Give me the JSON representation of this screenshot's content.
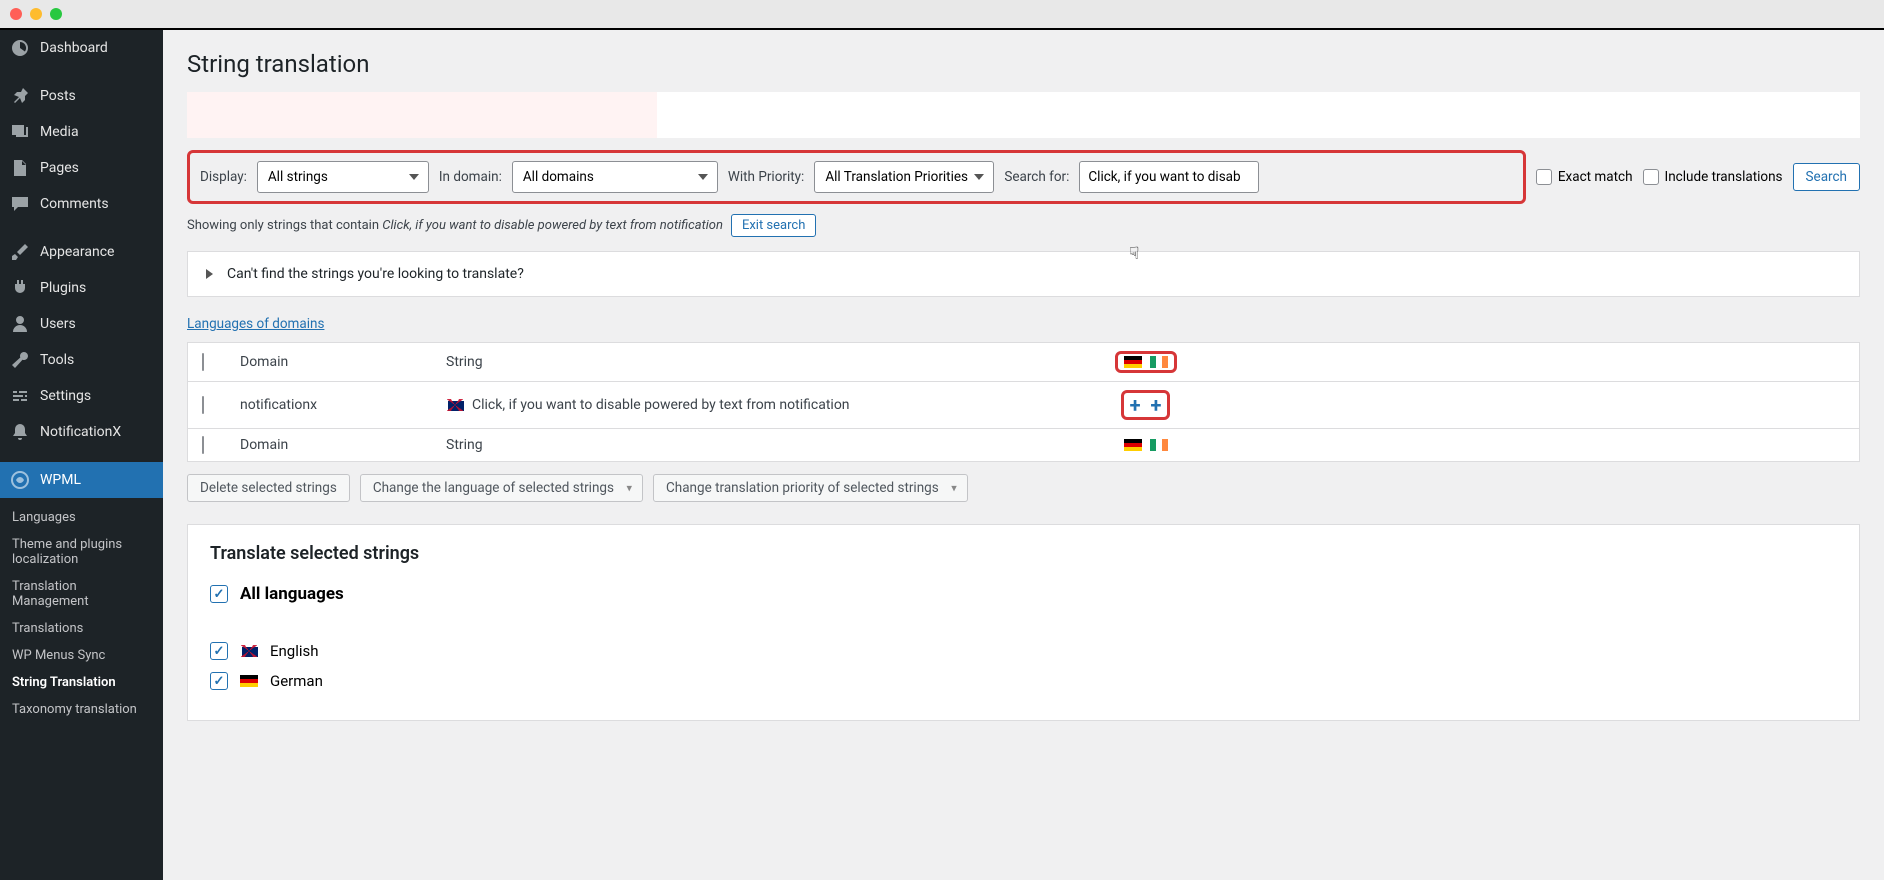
{
  "sidebar": {
    "items": [
      {
        "label": "Dashboard",
        "icon": "dashboard"
      },
      {
        "label": "Posts",
        "icon": "pin"
      },
      {
        "label": "Media",
        "icon": "media"
      },
      {
        "label": "Pages",
        "icon": "page"
      },
      {
        "label": "Comments",
        "icon": "comment"
      },
      {
        "label": "Appearance",
        "icon": "brush"
      },
      {
        "label": "Plugins",
        "icon": "plug"
      },
      {
        "label": "Users",
        "icon": "user"
      },
      {
        "label": "Tools",
        "icon": "wrench"
      },
      {
        "label": "Settings",
        "icon": "sliders"
      },
      {
        "label": "NotificationX",
        "icon": "notificationx"
      },
      {
        "label": "WPML",
        "icon": "wpml"
      }
    ],
    "submenu": [
      {
        "label": "Languages"
      },
      {
        "label": "Theme and plugins localization"
      },
      {
        "label": "Translation Management"
      },
      {
        "label": "Translations"
      },
      {
        "label": "WP Menus Sync"
      },
      {
        "label": "String Translation",
        "current": true
      },
      {
        "label": "Taxonomy translation"
      }
    ]
  },
  "page": {
    "title": "String translation"
  },
  "filters": {
    "display_label": "Display:",
    "display_value": "All strings",
    "domain_label": "In domain:",
    "domain_value": "All domains",
    "priority_label": "With Priority:",
    "priority_value": "All Translation Priorities",
    "search_label": "Search for:",
    "search_value": "Click, if you want to disab",
    "exact_match_label": "Exact match",
    "include_translations_label": "Include translations",
    "search_btn": "Search"
  },
  "showing": {
    "prefix": "Showing only strings that contain ",
    "term": "Click, if you want to disable powered by text from notification",
    "exit": "Exit search"
  },
  "accordion": {
    "text": "Can't find the strings you're looking to translate?"
  },
  "link_languages_of_domains": "Languages of domains",
  "table": {
    "headers": {
      "domain": "Domain",
      "string": "String"
    },
    "rows": [
      {
        "domain": "notificationx",
        "string": "Click, if you want to disable powered by text from notification"
      }
    ]
  },
  "actions": {
    "delete": "Delete selected strings",
    "change_lang": "Change the language of selected strings",
    "change_priority": "Change translation priority of selected strings"
  },
  "translate_box": {
    "title": "Translate selected strings",
    "all": "All languages",
    "langs": [
      {
        "label": "English",
        "flag": "uk"
      },
      {
        "label": "German",
        "flag": "de"
      }
    ]
  }
}
